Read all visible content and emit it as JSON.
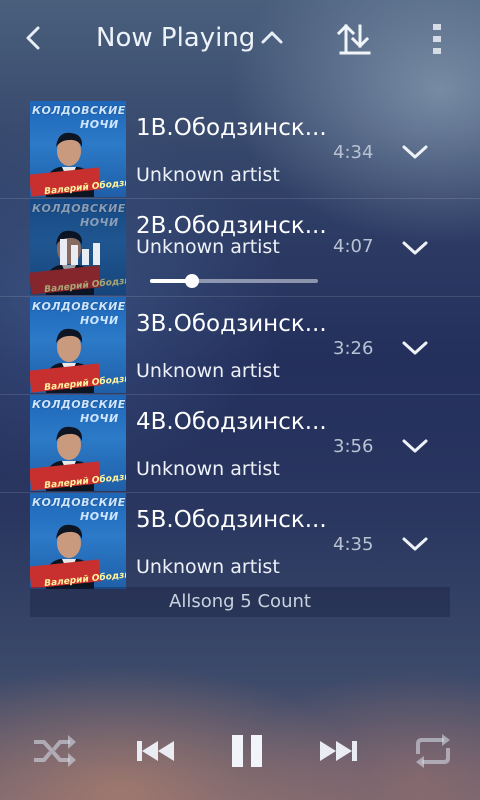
{
  "header": {
    "back_icon": "chevron-left-icon",
    "title": "Now Playing",
    "title_caret_icon": "chevron-up-icon",
    "sort_icon": "sort-arrows-icon",
    "menu_icon": "overflow-menu-icon"
  },
  "album_art": {
    "line1": "КОЛДОВСКИЕ",
    "line2": "НОЧИ",
    "badge": "Валерий Ободзинский"
  },
  "songs": [
    {
      "title": "1В.Ободзинск...",
      "artist": "Unknown artist",
      "duration": "4:34",
      "expand_icon": "chevron-down-icon"
    },
    {
      "title": "2В.Ободзинск...",
      "artist": "Unknown artist",
      "duration": "4:07",
      "expand_icon": "chevron-down-icon",
      "playing": true,
      "progress": 0.25
    },
    {
      "title": "3В.Ободзинск...",
      "artist": "Unknown artist",
      "duration": "3:26",
      "expand_icon": "chevron-down-icon"
    },
    {
      "title": "4В.Ободзинск...",
      "artist": "Unknown artist",
      "duration": "3:56",
      "expand_icon": "chevron-down-icon"
    },
    {
      "title": "5В.Ободзинск...",
      "artist": "Unknown artist",
      "duration": "4:35",
      "expand_icon": "chevron-down-icon"
    }
  ],
  "count_label": "Allsong 5 Count",
  "controls": {
    "shuffle_icon": "shuffle-icon",
    "previous_icon": "skip-previous-icon",
    "play_pause_icon": "pause-icon",
    "next_icon": "skip-next-icon",
    "repeat_icon": "repeat-icon"
  },
  "colors": {
    "accent": "#ffffff",
    "secondary_text": "#b8c2d2",
    "album_red": "#c7302e",
    "album_blue": "#1e66b8"
  }
}
